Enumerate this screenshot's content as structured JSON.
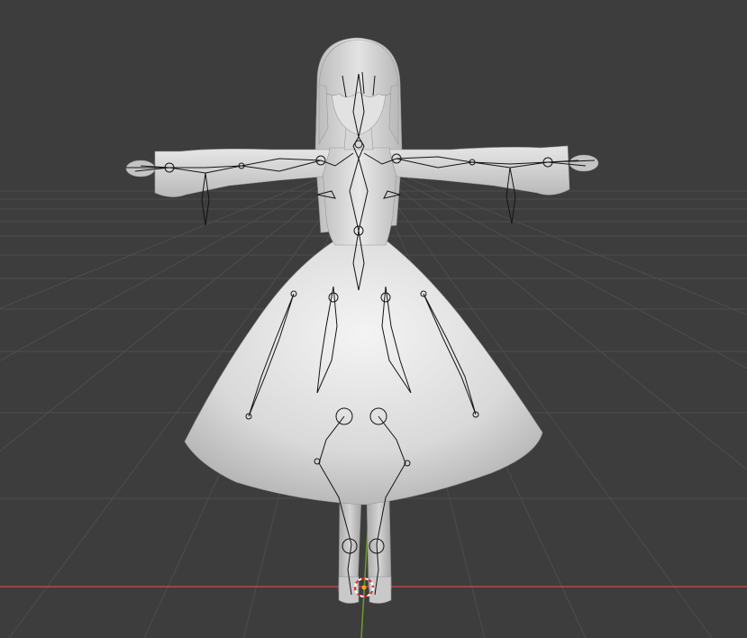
{
  "viewport": {
    "background_color": "#3d3d3d",
    "grid_color": "#4b4b4b",
    "x_axis_color": "#b9464d",
    "y_axis_color": "#6e9c2c"
  },
  "scene": {
    "object": "character-mesh",
    "shading": "solid",
    "mesh_color": "#d2d2d2",
    "armature_color": "#141414",
    "pose": "t-pose"
  },
  "origin_marker": {
    "icon": "3d-cursor-icon",
    "colors": [
      "#ffffff",
      "#e0282a"
    ]
  }
}
